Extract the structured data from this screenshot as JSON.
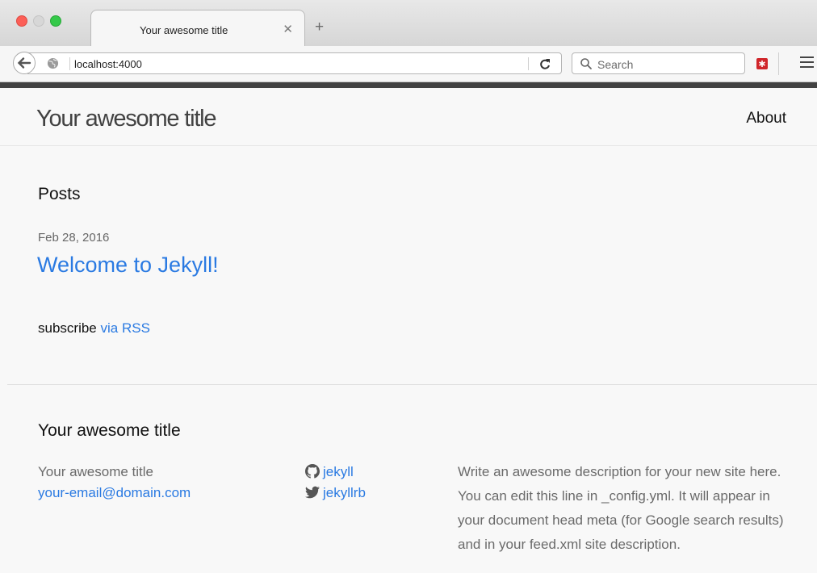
{
  "browser": {
    "tab_title": "Your awesome title",
    "url": "localhost:4000",
    "search_placeholder": "Search"
  },
  "header": {
    "site_title": "Your awesome title",
    "nav": [
      {
        "label": "About"
      }
    ]
  },
  "main": {
    "heading": "Posts",
    "posts": [
      {
        "date": "Feb 28, 2016",
        "title": "Welcome to Jekyll!"
      }
    ],
    "subscribe_prefix": "subscribe",
    "subscribe_link": "via RSS"
  },
  "footer": {
    "heading": "Your awesome title",
    "name": "Your awesome title",
    "email": "your-email@domain.com",
    "github_username": "jekyll",
    "twitter_username": "jekyllrb",
    "description": "Write an awesome description for your new site here. You can edit this line in _config.yml. It will appear in your document head meta (for Google search results) and in your feed.xml site description."
  },
  "colors": {
    "link": "#2a7ae2",
    "text": "#111111",
    "muted": "#6a6a6a",
    "page_background": "#f8f8f8"
  }
}
